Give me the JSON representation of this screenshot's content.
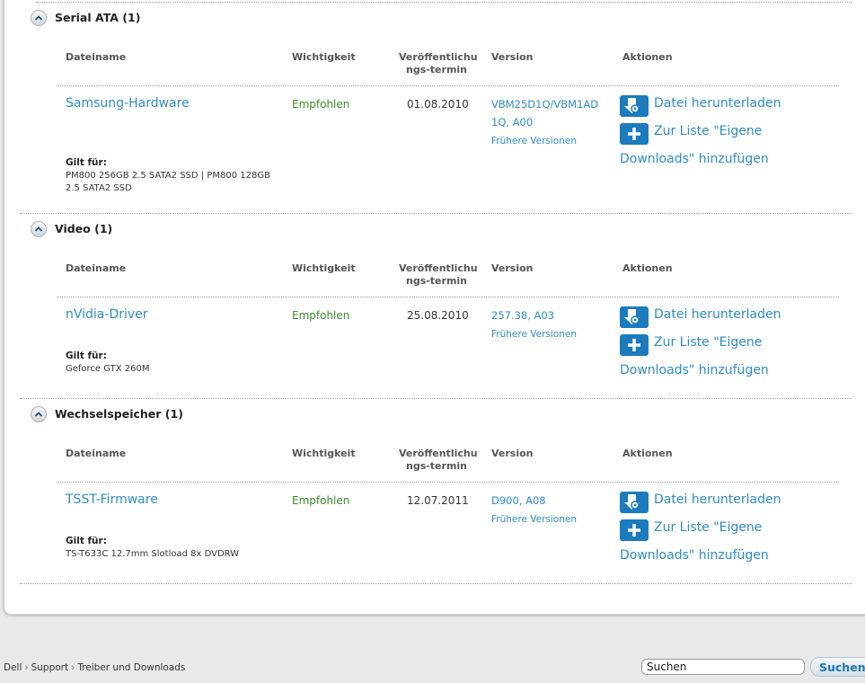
{
  "columns": {
    "filename": "Dateiname",
    "importance": "Wichtigkeit",
    "release_date": "Veröffentlichu ngs-termin",
    "version": "Version",
    "actions": "Aktionen"
  },
  "sections": [
    {
      "title": "Serial ATA (1)",
      "file": "Samsung-Hardware",
      "importance": "Empfohlen",
      "date": "01.08.2010",
      "version": "VBM25D1Q/VBM1AD 1Q, A00",
      "prev_versions": "Frühere Versionen",
      "applies_label": "Gilt für:",
      "applies": "PM800 256GB 2.5 SATA2 SSD | PM800 128GB 2.5 SATA2 SSD",
      "download": "Datei herunterladen",
      "add_list_1": "Zur Liste \"Eigene",
      "add_list_2": "Downloads\" hinzufügen"
    },
    {
      "title": "Video (1)",
      "file": "nVidia-Driver",
      "importance": "Empfohlen",
      "date": "25.08.2010",
      "version": "257.38, A03",
      "prev_versions": "Frühere Versionen",
      "applies_label": "Gilt für:",
      "applies": "Geforce GTX 260M",
      "download": "Datei herunterladen",
      "add_list_1": "Zur Liste \"Eigene",
      "add_list_2": "Downloads\" hinzufügen"
    },
    {
      "title": "Wechselspeicher (1)",
      "file": "TSST-Firmware",
      "importance": "Empfohlen",
      "date": "12.07.2011",
      "version": "D900, A08",
      "prev_versions": "Frühere Versionen",
      "applies_label": "Gilt für:",
      "applies": "TS-T633C 12.7mm Slotload 8x DVDRW",
      "download": "Datei herunterladen",
      "add_list_1": "Zur Liste \"Eigene",
      "add_list_2": "Downloads\" hinzufügen"
    }
  ],
  "footer": {
    "breadcrumb": [
      "Dell",
      "Support",
      "Treiber und Downloads"
    ],
    "search_value": "Suchen",
    "search_button": "Suchen"
  }
}
